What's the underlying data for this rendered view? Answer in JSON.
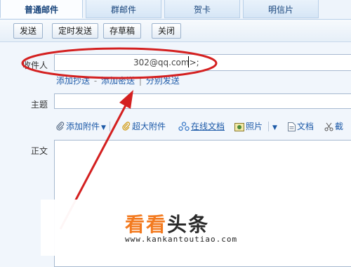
{
  "tabs": [
    {
      "label": "普通邮件",
      "active": true
    },
    {
      "label": "群邮件",
      "active": false
    },
    {
      "label": "贺卡",
      "active": false
    },
    {
      "label": "明信片",
      "active": false
    }
  ],
  "toolbar": {
    "send": "发送",
    "scheduled_send": "定时发送",
    "save_draft": "存草稿",
    "close": "关闭"
  },
  "form": {
    "recipient_label": "收件人",
    "recipient_value": "302@qq.com>;",
    "add_cc": "添加抄送",
    "link_separator": " - ",
    "add_bcc": "添加密送",
    "pipe": "|",
    "separate_send": "分别发送",
    "subject_label": "主题",
    "subject_value": "",
    "body_label": "正文"
  },
  "attach_bar": {
    "add_attachment": "添加附件",
    "large_attachment": "超大附件",
    "online_doc": "在线文档",
    "photo": "照片",
    "document": "文档",
    "screenshot": "截"
  },
  "watermark": {
    "logo_a": "看看",
    "logo_b": "头条",
    "url": "www.kankantoutiao.com"
  },
  "colors": {
    "link": "#1d5aa8",
    "annotation": "#d42020",
    "watermark_orange": "#f37a1f"
  }
}
